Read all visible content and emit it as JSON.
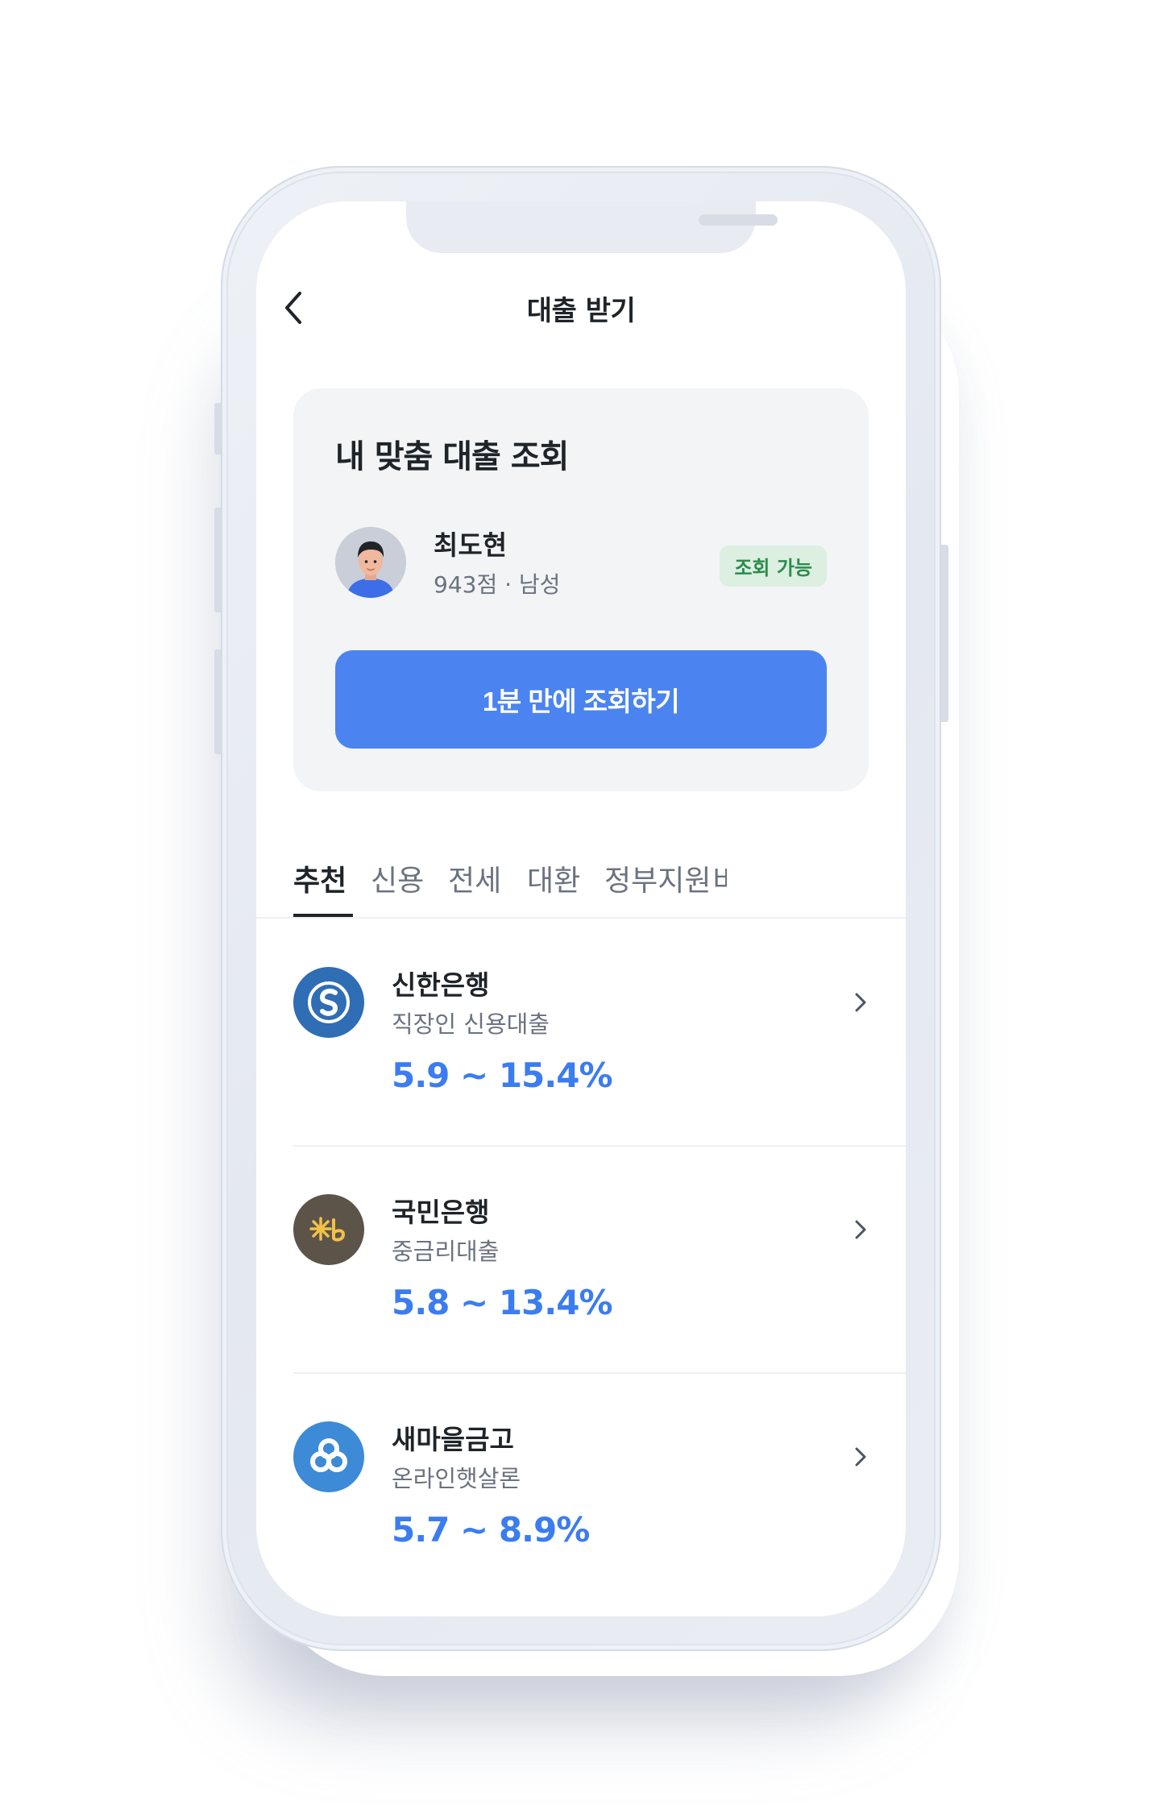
{
  "header": {
    "title": "대출 받기"
  },
  "card": {
    "title": "내 맞춤 대출 조회",
    "user_name": "최도현",
    "user_meta": "943점 · 남성",
    "status_badge": "조회 가능",
    "cta_label": "1분 만에 조회하기"
  },
  "tabs": [
    {
      "label": "추천",
      "active": true
    },
    {
      "label": "신용",
      "active": false
    },
    {
      "label": "전세",
      "active": false
    },
    {
      "label": "대환",
      "active": false
    },
    {
      "label": "정부지원",
      "active": false
    },
    {
      "label": "비",
      "active": false
    }
  ],
  "loans": [
    {
      "bank": "신한은행",
      "product": "직장인 신용대출",
      "rate": "5.9 ~ 15.4%",
      "logo_color": "#2f6db5",
      "logo_icon": "shinhan-logo-icon"
    },
    {
      "bank": "국민은행",
      "product": "중금리대출",
      "rate": "5.8 ~ 13.4%",
      "logo_color": "#5c5448",
      "logo_icon": "kb-logo-icon"
    },
    {
      "bank": "새마을금고",
      "product": "온라인햇살론",
      "rate": "5.7 ~ 8.9%",
      "logo_color": "#3d8ad6",
      "logo_icon": "mg-logo-icon"
    }
  ],
  "colors": {
    "accent": "#4b84f0",
    "rate": "#3b7cf0",
    "badge_bg": "#dcefe1",
    "badge_text": "#2e8b4e"
  }
}
